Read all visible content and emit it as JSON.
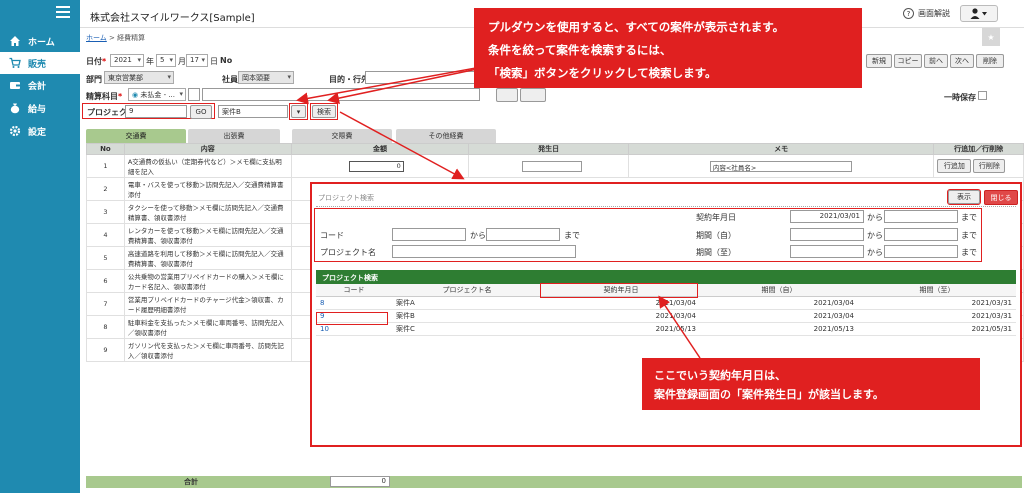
{
  "sidebar": {
    "items": [
      {
        "label": "ホーム",
        "icon": "home-icon"
      },
      {
        "label": "販売",
        "icon": "cart-icon"
      },
      {
        "label": "会計",
        "icon": "wallet-icon"
      },
      {
        "label": "給与",
        "icon": "money-bag-icon"
      },
      {
        "label": "設定",
        "icon": "gear-icon"
      }
    ]
  },
  "header": {
    "company": "株式会社スマイルワークス[Sample]",
    "help": "画面解説"
  },
  "breadcrumb": {
    "home": "ホーム",
    "sep": " > ",
    "current": "経費精算"
  },
  "form": {
    "date_label": "日付",
    "year": "2021",
    "year_unit": "年",
    "month": "5",
    "month_unit": "月",
    "day": "17",
    "day_unit": "日",
    "no_label": "No",
    "dept_label": "部門",
    "dept_value": "東京営業部",
    "staff_label": "社員",
    "staff_value": "岡本頭要",
    "purpose_label": "目的・行先",
    "account_label": "精算科目",
    "account_value": "未払金 - ...",
    "project_label": "プロジェクト",
    "project_value": "9",
    "go_label": "GO",
    "case_value": "案件B",
    "search_label": "検索",
    "temp_save_label": "一時保存",
    "buttons": [
      "新規",
      "コピー",
      "前へ",
      "次へ",
      "削除"
    ]
  },
  "tabs": [
    "交通費",
    "出張費",
    "交際費",
    "その他経費"
  ],
  "main_table": {
    "headers": [
      "No",
      "内容",
      "金額",
      "発生日",
      "メモ",
      "行追加／行削除"
    ],
    "amount_value": "0",
    "memo_value": "内容<社員名>",
    "row_add": "行追加",
    "row_delete": "行削除",
    "rows": [
      {
        "no": "1",
        "content": "A交通費の仮払い（定期券代など）＞メモ欄に支払明細を記入"
      },
      {
        "no": "2",
        "content": "電車・バスを使って移動＞訪問先記入／交通費精算書添付"
      },
      {
        "no": "3",
        "content": "タクシーを使って移動＞メモ欄に訪問先記入／交通費精算書、領収書添付"
      },
      {
        "no": "4",
        "content": "レンタカーを使って移動＞メモ欄に訪問先記入／交通費精算書、領収書添付"
      },
      {
        "no": "5",
        "content": "高速道路を利用して移動＞メモ欄に訪問先記入／交通費精算書、領収書添付"
      },
      {
        "no": "6",
        "content": "公共乗物の営業用プリペイドカードの購入＞メモ欄にカード名記入、領収書添付"
      },
      {
        "no": "7",
        "content": "営業用プリペイドカードのチャージ代金＞領収書、カード履歴明細書添付"
      },
      {
        "no": "8",
        "content": "駐車料金を支払った＞メモ欄に車両番号、訪問先記入／領収書添付"
      },
      {
        "no": "9",
        "content": "ガソリン代を支払った＞メモ欄に車両番号、訪問先記入／領収書添付"
      }
    ],
    "total_label": "合計",
    "total_value": "0"
  },
  "popup": {
    "title": "プロジェクト検索",
    "show_label": "表示",
    "close_label": "閉じる",
    "contract_date_label": "契約年月日",
    "contract_date_value": "2021/03/01",
    "from": "から",
    "to": "まで",
    "code_label": "コード",
    "period_from_label": "期間（自）",
    "period_to_label": "期間（至）",
    "project_name_label": "プロジェクト名",
    "result_title": "プロジェクト検索",
    "result_headers": [
      "コード",
      "プロジェクト名",
      "契約年月日",
      "期間（自）",
      "期間（至）"
    ],
    "results": [
      {
        "code": "8",
        "name": "案件A",
        "contract": "2021/03/04",
        "from": "2021/03/04",
        "to": "2021/03/31"
      },
      {
        "code": "9",
        "name": "案件B",
        "contract": "2021/03/04",
        "from": "2021/03/04",
        "to": "2021/03/31"
      },
      {
        "code": "10",
        "name": "案件C",
        "contract": "2021/05/13",
        "from": "2021/05/13",
        "to": "2021/05/31"
      }
    ]
  },
  "callouts": {
    "top": [
      "プルダウンを使用すると、すべての案件が表示されます。",
      "条件を絞って案件を検索するには、",
      "「検索」ボタンをクリックして検索します。"
    ],
    "bottom": [
      "ここでいう契約年月日は、",
      "案件登録画面の「案件発生日」が該当します。"
    ]
  },
  "colors": {
    "sidebar": "#1f8ab0",
    "accent_red": "#e02020",
    "green_header": "#2e7d32",
    "tab_active": "#a8c98e"
  }
}
